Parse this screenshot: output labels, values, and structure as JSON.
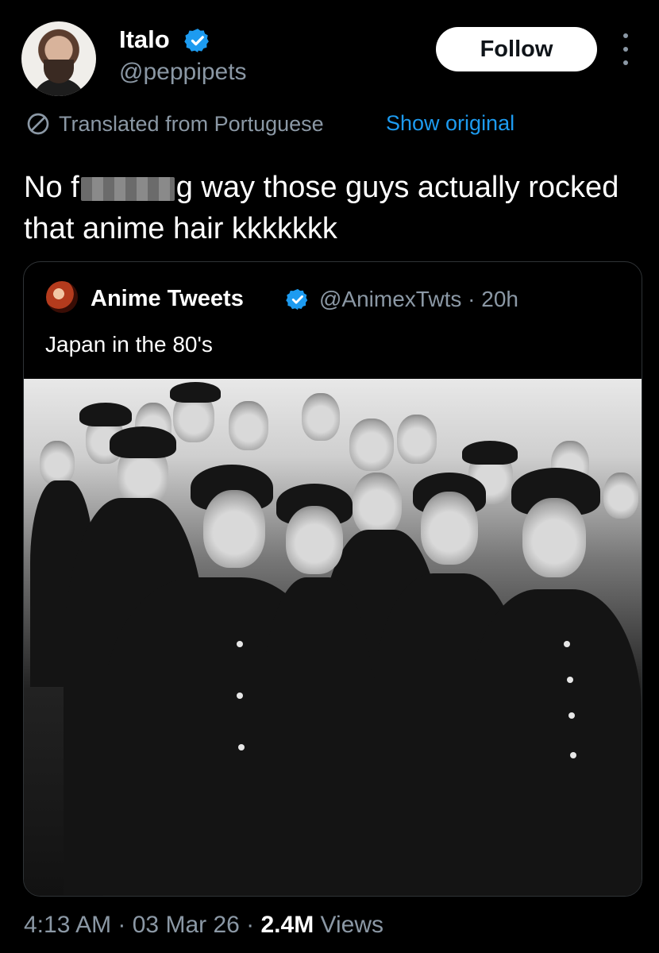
{
  "author": {
    "name": "Italo",
    "handle": "@peppipets",
    "verified": true
  },
  "follow_label": "Follow",
  "translation": {
    "note": "Translated from Portuguese",
    "show_original": "Show original"
  },
  "tweet": {
    "text_before": "No f",
    "text_after": "g way those guys actually rocked that anime hair kkkkkkk"
  },
  "quote": {
    "name": "Anime Tweets",
    "handle": "@AnimexTwts",
    "time": "· 20h",
    "text": "Japan in the 80's",
    "verified": true
  },
  "meta": {
    "time": "4:13 AM",
    "date": "· 03 Mar 26 ·",
    "views_count": "2.4M",
    "views_label": "Views"
  },
  "colors": {
    "background": "#000000",
    "link": "#1d9bf0",
    "secondary_text": "#8b98a5",
    "verified": "#1d9bf0"
  }
}
